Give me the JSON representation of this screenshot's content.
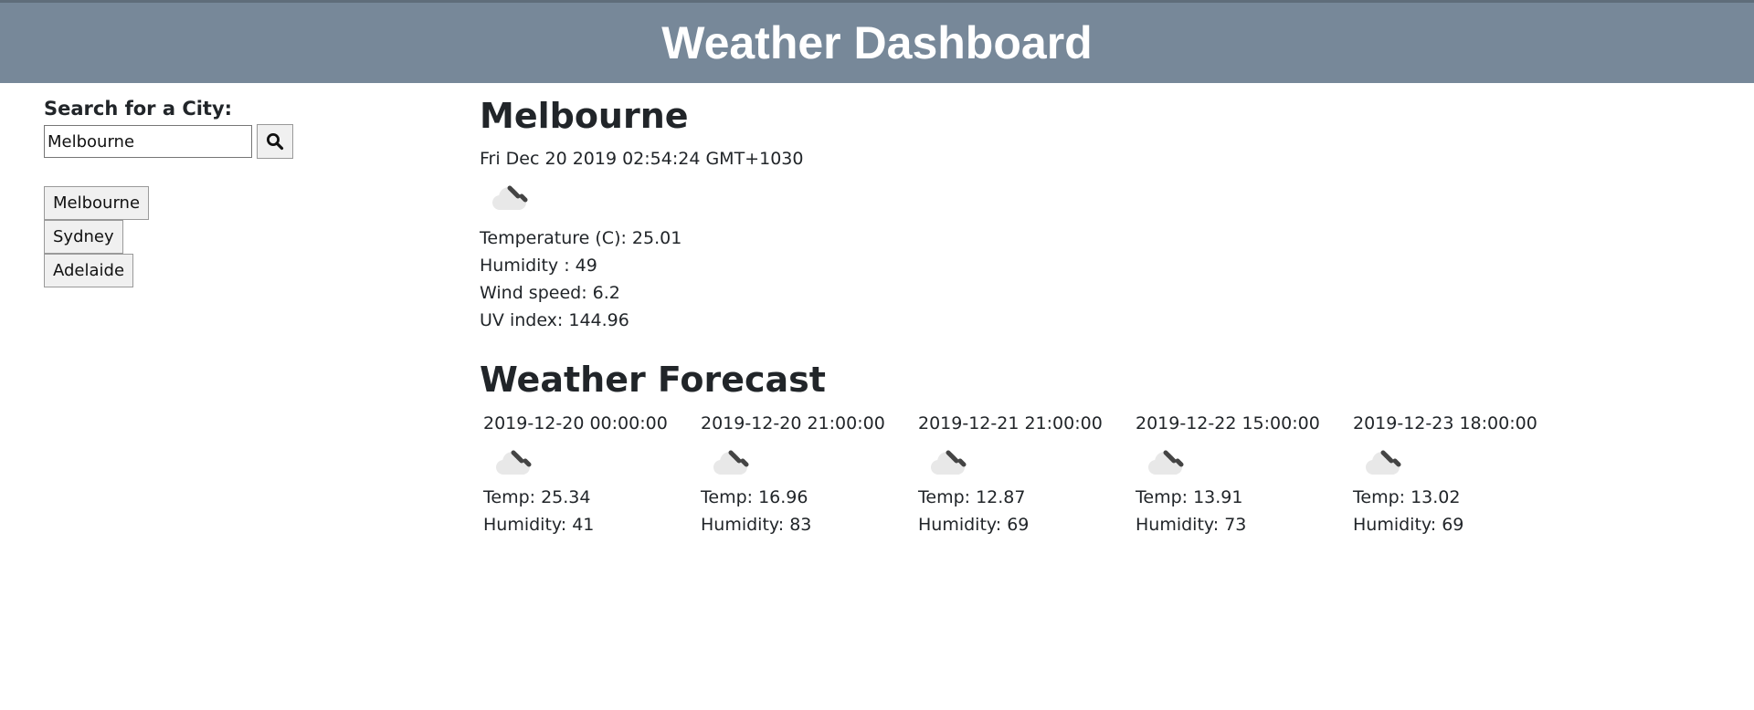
{
  "header": {
    "title": "Weather Dashboard"
  },
  "sidebar": {
    "search_label": "Search for a City:",
    "search_value": "Melbourne",
    "search_icon": "search-icon",
    "history": [
      "Melbourne",
      "Sydney",
      "Adelaide"
    ]
  },
  "current": {
    "city": "Melbourne",
    "datetime": "Fri Dec 20 2019 02:54:24 GMT+1030",
    "icon": "cloud-drizzle-icon",
    "temperature": "Temperature (C): 25.01",
    "humidity": "Humidity : 49",
    "wind": "Wind speed: 6.2",
    "uv": "UV index: 144.96"
  },
  "forecast": {
    "title": "Weather Forecast",
    "days": [
      {
        "date": "2019-12-20 00:00:00",
        "temp": "Temp: 25.34",
        "humidity": "Humidity: 41"
      },
      {
        "date": "2019-12-20 21:00:00",
        "temp": "Temp: 16.96",
        "humidity": "Humidity: 83"
      },
      {
        "date": "2019-12-21 21:00:00",
        "temp": "Temp: 12.87",
        "humidity": "Humidity: 69"
      },
      {
        "date": "2019-12-22 15:00:00",
        "temp": "Temp: 13.91",
        "humidity": "Humidity: 73"
      },
      {
        "date": "2019-12-23 18:00:00",
        "temp": "Temp: 13.02",
        "humidity": "Humidity: 69"
      }
    ]
  },
  "colors": {
    "header_bg": "#778899",
    "header_text": "#ffffff",
    "text": "#212529"
  }
}
